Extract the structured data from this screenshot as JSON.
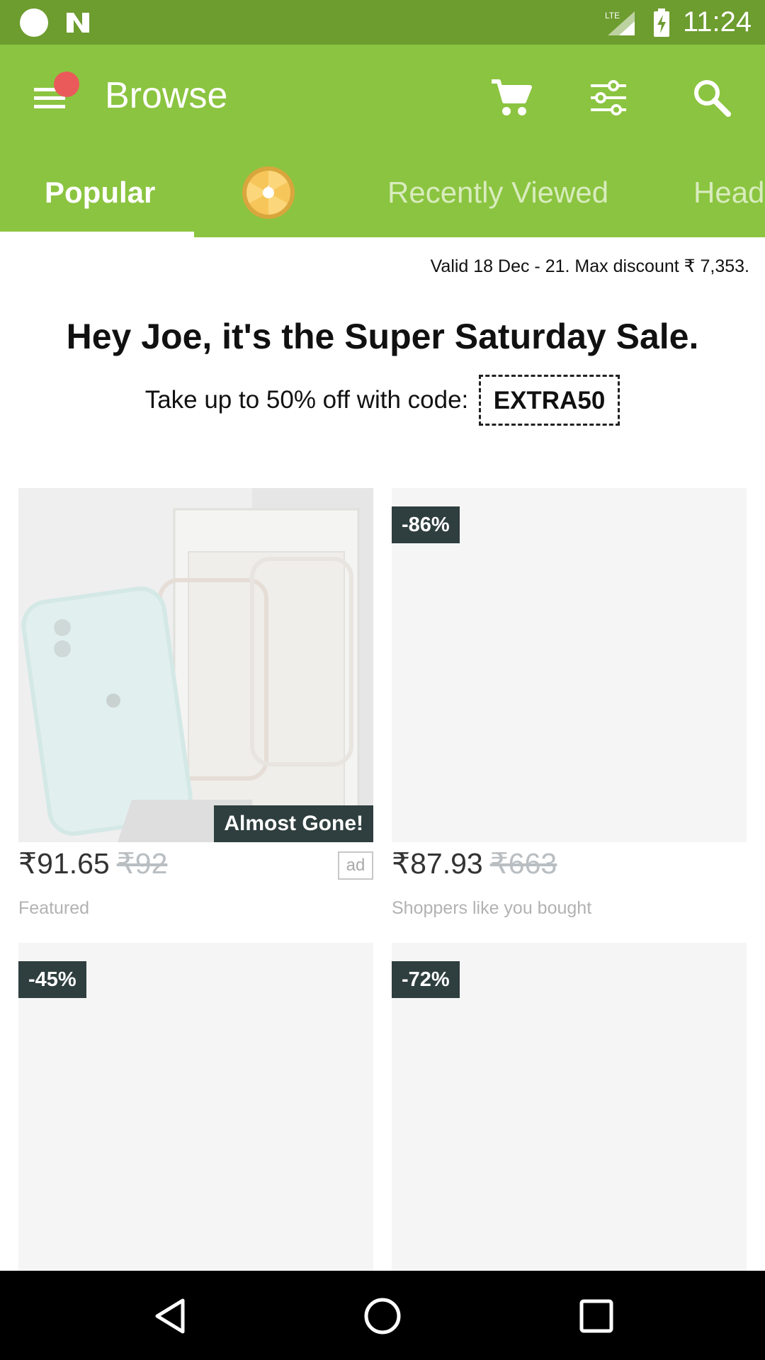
{
  "status_bar": {
    "time": "11:24",
    "network_label": "LTE"
  },
  "app_bar": {
    "title": "Browse",
    "icons": [
      "menu-icon",
      "cart-icon",
      "filter-icon",
      "search-icon"
    ],
    "notification_dot_color": "#eb5a5a"
  },
  "tabs": [
    {
      "label": "Popular",
      "selected": true
    },
    {
      "label": "",
      "icon": "wheel-icon"
    },
    {
      "label": "Recently Viewed"
    },
    {
      "label": "Head"
    }
  ],
  "promo": {
    "valid_text": "Valid 18 Dec - 21. Max discount ₹ 7,353.",
    "title": "Hey Joe, it's the Super Saturday Sale.",
    "subtitle": "Take up to 50% off with code:",
    "code": "EXTRA50"
  },
  "products": [
    {
      "badge": "",
      "label": "Almost Gone!",
      "price": "₹91.65",
      "old_price": "₹92",
      "ad": "ad",
      "caption": "Featured"
    },
    {
      "badge": "-86%",
      "label": "",
      "price": "₹87.93",
      "old_price": "₹663",
      "ad": "",
      "caption": "Shoppers like you bought"
    },
    {
      "badge": "-45%"
    },
    {
      "badge": "-72%"
    }
  ],
  "colors": {
    "status_bar": "#6d9c2f",
    "app_bar": "#8bc440",
    "badge_bg": "#2f3e3e"
  }
}
